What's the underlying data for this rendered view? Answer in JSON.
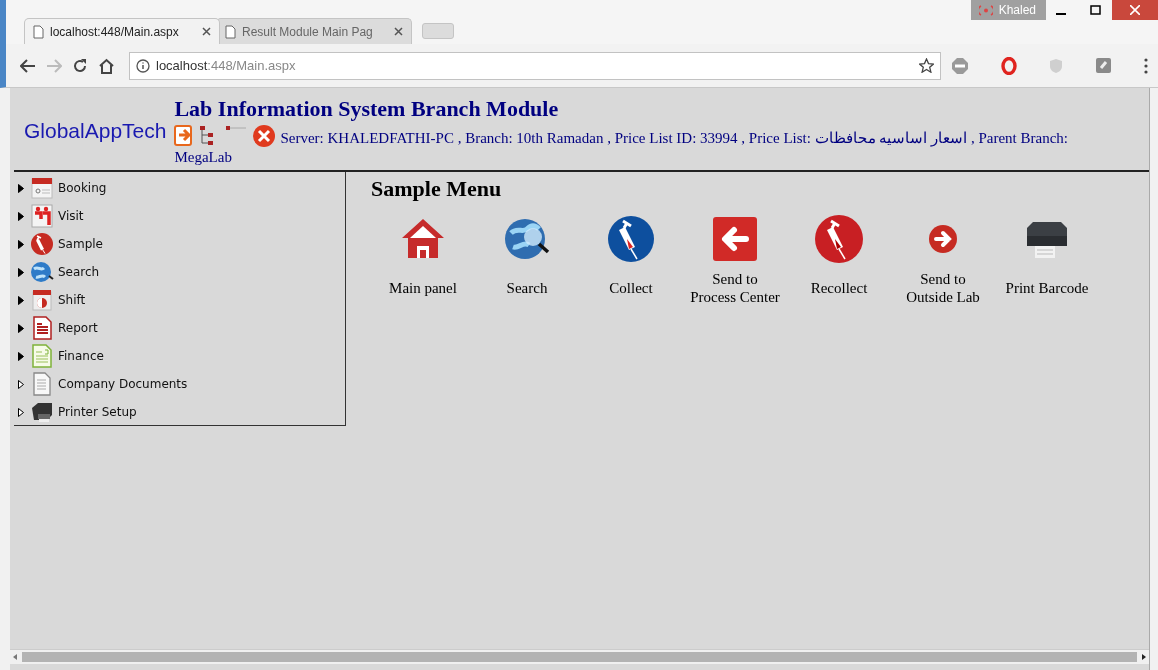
{
  "browser": {
    "tabs": [
      {
        "label": "localhost:448/Main.aspx",
        "selected": true
      },
      {
        "label": "Result Module Main Pag",
        "selected": false
      }
    ],
    "user": "Khaled",
    "address": {
      "host": "localhost",
      "rest": ":448/Main.aspx"
    }
  },
  "header": {
    "logo": "GlobalAppTech",
    "title": "Lab Information System Branch Module",
    "info": "Server: KHALEDFATHI-PC , Branch: 10th Ramadan , Price List ID: 33994 , Price List: اسعار اساسيه محافظات , Parent Branch: MegaLab"
  },
  "sidebar": {
    "items": [
      {
        "label": "Booking",
        "has_children": true
      },
      {
        "label": "Visit",
        "has_children": true
      },
      {
        "label": "Sample",
        "has_children": true
      },
      {
        "label": "Search",
        "has_children": true
      },
      {
        "label": "Shift",
        "has_children": true
      },
      {
        "label": "Report",
        "has_children": true
      },
      {
        "label": "Finance",
        "has_children": true
      },
      {
        "label": "Company Documents",
        "has_children": false
      },
      {
        "label": "Printer Setup",
        "has_children": false
      }
    ]
  },
  "menu": {
    "title": "Sample Menu",
    "items": [
      {
        "label": "Main panel"
      },
      {
        "label": "Search"
      },
      {
        "label": "Collect"
      },
      {
        "label": "Send to Process Center"
      },
      {
        "label": "Recollect"
      },
      {
        "label": "Send to Outside Lab"
      },
      {
        "label": "Print Barcode"
      }
    ]
  }
}
